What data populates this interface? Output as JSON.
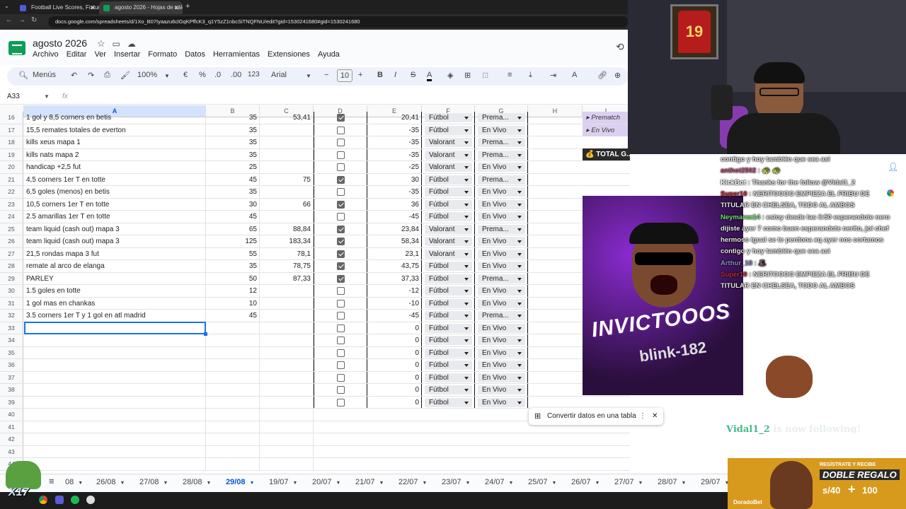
{
  "browser": {
    "tabs": [
      {
        "label": "Football Live Scores, Fixtures &",
        "color": "#4f5bd5"
      },
      {
        "label": "agosto 2026 - Hojas de cálculo",
        "color": "#0f9d58"
      }
    ],
    "url": "docs.google.com/spreadsheets/d/1Xo_B07Iyaazu6clGqKPffcK3_q1Y5zZ1nbcSiTNQFNU/edit?gid=1530241680#gid=1530241680"
  },
  "doc": {
    "title": "agosto 2026",
    "menu": [
      "Archivo",
      "Editar",
      "Ver",
      "Insertar",
      "Formato",
      "Datos",
      "Herramientas",
      "Extensiones",
      "Ayuda"
    ]
  },
  "toolbar": {
    "menus": "Menús",
    "zoom": "100%",
    "currency": "€",
    "percent": "%",
    "dec_less": ".0",
    "dec_more": ".00",
    "numfmt": "123",
    "font": "Arial",
    "size": "10",
    "bold": "B",
    "italic": "I",
    "strike": "S",
    "textcolor": "A"
  },
  "formula": {
    "cellref": "A33",
    "fx": "fx"
  },
  "columns": [
    "A",
    "B",
    "C",
    "D",
    "E",
    "F",
    "G",
    "H",
    "I"
  ],
  "rows": [
    {
      "n": "16",
      "a": "1 gol y 8,5 corners en betis",
      "b": "35",
      "c": "53,41",
      "chk": true,
      "e": "20,41",
      "f": "Fútbol",
      "g": "Prema..."
    },
    {
      "n": "17",
      "a": "15,5 remates totales de everton",
      "b": "35",
      "c": "",
      "chk": false,
      "e": "-35",
      "f": "Fútbol",
      "g": "En Vivo"
    },
    {
      "n": "18",
      "a": "kills xeus mapa 1",
      "b": "35",
      "c": "",
      "chk": false,
      "e": "-35",
      "f": "Valorant",
      "g": "Prema..."
    },
    {
      "n": "19",
      "a": "kills nats mapa 2",
      "b": "35",
      "c": "",
      "chk": false,
      "e": "-35",
      "f": "Valorant",
      "g": "Prema..."
    },
    {
      "n": "20",
      "a": "handicap +2,5 fut",
      "b": "25",
      "c": "",
      "chk": false,
      "e": "-25",
      "f": "Valorant",
      "g": "En Vivo"
    },
    {
      "n": "21",
      "a": "4,5 corners 1er T en totte",
      "b": "45",
      "c": "75",
      "chk": true,
      "e": "30",
      "f": "Fútbol",
      "g": "Prema..."
    },
    {
      "n": "22",
      "a": "6,5 goles (menos) en betis",
      "b": "35",
      "c": "",
      "chk": false,
      "e": "-35",
      "f": "Fútbol",
      "g": "En Vivo"
    },
    {
      "n": "23",
      "a": "10,5 corners 1er T en totte",
      "b": "30",
      "c": "66",
      "chk": true,
      "e": "36",
      "f": "Fútbol",
      "g": "En Vivo"
    },
    {
      "n": "24",
      "a": "2.5 amarillas 1er T en totte",
      "b": "45",
      "c": "",
      "chk": false,
      "e": "-45",
      "f": "Fútbol",
      "g": "En Vivo"
    },
    {
      "n": "25",
      "a": "team liquid (cash out) mapa 3",
      "b": "65",
      "c": "88,84",
      "chk": true,
      "e": "23,84",
      "f": "Valorant",
      "g": "Prema..."
    },
    {
      "n": "26",
      "a": "team liquid (cash out) mapa 3",
      "b": "125",
      "c": "183,34",
      "chk": true,
      "e": "58,34",
      "f": "Valorant",
      "g": "En Vivo"
    },
    {
      "n": "27",
      "a": "21,5 rondas mapa 3 fut",
      "b": "55",
      "c": "78,1",
      "chk": true,
      "e": "23,1",
      "f": "Valorant",
      "g": "En Vivo"
    },
    {
      "n": "28",
      "a": "remate al arco de elanga",
      "b": "35",
      "c": "78,75",
      "chk": true,
      "e": "43,75",
      "f": "Fútbol",
      "g": "En Vivo"
    },
    {
      "n": "29",
      "a": "PARLEY",
      "b": "50",
      "c": "87,33",
      "chk": true,
      "e": "37,33",
      "f": "Fútbol",
      "g": "Prema..."
    },
    {
      "n": "30",
      "a": "1.5 goles en totte",
      "b": "12",
      "c": "",
      "chk": false,
      "e": "-12",
      "f": "Fútbol",
      "g": "En Vivo"
    },
    {
      "n": "31",
      "a": "1 gol mas en chankas",
      "b": "10",
      "c": "",
      "chk": false,
      "e": "-10",
      "f": "Fútbol",
      "g": "En Vivo"
    },
    {
      "n": "32",
      "a": "3.5 corners 1er T y 1 gol en atl madrid",
      "b": "45",
      "c": "",
      "chk": false,
      "e": "-45",
      "f": "Fútbol",
      "g": "Prema..."
    },
    {
      "n": "33",
      "a": "",
      "b": "",
      "c": "",
      "chk": false,
      "e": "0",
      "f": "Fútbol",
      "g": "En Vivo"
    },
    {
      "n": "34",
      "a": "",
      "b": "",
      "c": "",
      "chk": false,
      "e": "0",
      "f": "Fútbol",
      "g": "En Vivo"
    },
    {
      "n": "35",
      "a": "",
      "b": "",
      "c": "",
      "chk": false,
      "e": "0",
      "f": "Fútbol",
      "g": "En Vivo"
    },
    {
      "n": "36",
      "a": "",
      "b": "",
      "c": "",
      "chk": false,
      "e": "0",
      "f": "Fútbol",
      "g": "En Vivo"
    },
    {
      "n": "37",
      "a": "",
      "b": "",
      "c": "",
      "chk": false,
      "e": "0",
      "f": "Fútbol",
      "g": "En Vivo"
    },
    {
      "n": "38",
      "a": "",
      "b": "",
      "c": "",
      "chk": false,
      "e": "0",
      "f": "Fútbol",
      "g": "En Vivo"
    },
    {
      "n": "39",
      "a": "",
      "b": "",
      "c": "",
      "chk": false,
      "e": "0",
      "f": "Fútbol",
      "g": "En Vivo"
    }
  ],
  "empty_rows": [
    "40",
    "41",
    "42",
    "43",
    "44"
  ],
  "side_panel": {
    "item1": "Prematch",
    "item2": "En Vivo",
    "total": "TOTAL G..."
  },
  "toast": {
    "label": "Convertir datos en una tabla"
  },
  "sheet_tabs": [
    "08",
    "26/08",
    "27/08",
    "28/08",
    "29/08",
    "19/07",
    "20/07",
    "21/07",
    "22/07",
    "23/07",
    "24/07",
    "25/07",
    "26/07",
    "27/07",
    "28/07",
    "29/07"
  ],
  "active_sheet": "29/08",
  "stream": {
    "jersey_number": "19"
  },
  "chat": [
    {
      "user": "",
      "text": "contigo y hoy también que sea asi",
      "color": "#e6e6e6"
    },
    {
      "user": "anthot2502",
      "text": " : 🐢 🐢",
      "color": "#c04a7a"
    },
    {
      "user": "KickBot",
      "text": " : Thanks for the follow @Vidal1_2",
      "color": "#ffffff"
    },
    {
      "user": "Super10",
      "text": " : NERITOOOO EMPIEZA EL FRIBU DE",
      "color": "#c0283a"
    },
    {
      "user": "",
      "text": "TITULAR EN CHELSEA, TODO AL AMBOS",
      "color": "#e6e6e6"
    },
    {
      "user": "Neymarxx14",
      "text": " : estoy desde las 6:50 esperandote nero",
      "color": "#6ee26e"
    },
    {
      "user": "",
      "text": "dijiste ayer 7 como buen esperandote nerito, joi chef",
      "color": "#e6e6e6"
    },
    {
      "user": "",
      "text": "hermoso igual se te perdona xq ayer nos cortamos",
      "color": "#e6e6e6"
    },
    {
      "user": "",
      "text": "contigo y hoy también que sea asi",
      "color": "#e6e6e6"
    },
    {
      "user": "Arthur_18",
      "text": " : 🎩",
      "color": "#8a8ac8"
    },
    {
      "user": "Super10",
      "text": " : NERITOOOO EMPIEZA EL FRIBU DE",
      "color": "#c0283a"
    },
    {
      "user": "",
      "text": "TITULAR EN CHELSEA, TODO AL AMBOS",
      "color": "#e6e6e6"
    }
  ],
  "follow_alert": {
    "user": "Vidal1_2",
    "text": " is now following!"
  },
  "promo": {
    "main": "INVICTOOOS",
    "sub": "blink-182"
  },
  "ad": {
    "line1": "REGÍSTRATE Y RECIBE",
    "line2": "DOBLE REGALO",
    "amount1": "s/40",
    "amount2": "100",
    "brand": "DoradoBet"
  },
  "overlay": {
    "badge": "X17"
  }
}
